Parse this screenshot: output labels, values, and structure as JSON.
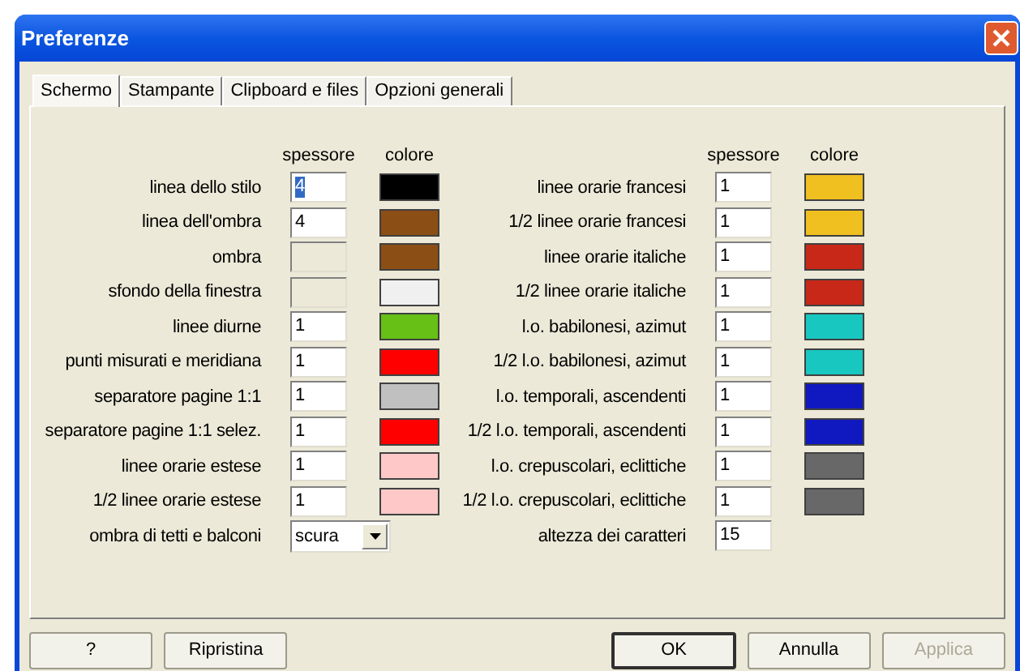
{
  "window": {
    "title": "Preferenze"
  },
  "tabs": [
    {
      "label": "Schermo",
      "selected": true
    },
    {
      "label": "Stampante",
      "selected": false
    },
    {
      "label": "Clipboard e files",
      "selected": false
    },
    {
      "label": "Opzioni generali",
      "selected": false
    }
  ],
  "headers": {
    "left": [
      "spessore",
      "colore"
    ],
    "right": [
      "spessore",
      "colore"
    ]
  },
  "left_rows": [
    {
      "kind": "color",
      "label": "linea dello stilo",
      "value": "4",
      "disabled": false,
      "selected": true,
      "color": "#000000"
    },
    {
      "kind": "color",
      "label": "linea dell'ombra",
      "value": "4",
      "disabled": false,
      "selected": false,
      "color": "#8b4e14"
    },
    {
      "kind": "color",
      "label": "ombra",
      "disabled": true,
      "color": "#8b4e14"
    },
    {
      "kind": "color",
      "label": "sfondo della finestra",
      "disabled": true,
      "color": "#f0f0f0"
    },
    {
      "kind": "color",
      "label": "linee diurne",
      "value": "1",
      "disabled": false,
      "selected": false,
      "color": "#66c016"
    },
    {
      "kind": "color",
      "label": "punti misurati e meridiana",
      "value": "1",
      "disabled": false,
      "selected": false,
      "color": "#ff0000"
    },
    {
      "kind": "color",
      "label": "separatore pagine 1:1",
      "value": "1",
      "disabled": false,
      "selected": false,
      "color": "#c0c0c0"
    },
    {
      "kind": "color",
      "label": "separatore pagine 1:1 selez.",
      "value": "1",
      "disabled": false,
      "selected": false,
      "color": "#ff0000"
    },
    {
      "kind": "color",
      "label": "linee orarie estese",
      "value": "1",
      "disabled": false,
      "selected": false,
      "color": "#ffc8c8"
    },
    {
      "kind": "color",
      "label": "1/2 linee orarie estese",
      "value": "1",
      "disabled": false,
      "selected": false,
      "color": "#ffc8c8"
    },
    {
      "kind": "select",
      "label": "ombra di tetti e balconi",
      "value": "scura"
    }
  ],
  "right_rows": [
    {
      "kind": "color",
      "label": "linee orarie francesi",
      "value": "1",
      "color": "#f0c020"
    },
    {
      "kind": "color",
      "label": "1/2 linee orarie francesi",
      "value": "1",
      "color": "#f0c020"
    },
    {
      "kind": "color",
      "label": "linee orarie italiche",
      "value": "1",
      "color": "#c82818"
    },
    {
      "kind": "color",
      "label": "1/2 linee orarie italiche",
      "value": "1",
      "color": "#c82818"
    },
    {
      "kind": "color",
      "label": "l.o. babilonesi, azimut",
      "value": "1",
      "color": "#18c8c0"
    },
    {
      "kind": "color",
      "label": "1/2 l.o. babilonesi, azimut",
      "value": "1",
      "color": "#18c8c0"
    },
    {
      "kind": "color",
      "label": "l.o. temporali, ascendenti",
      "value": "1",
      "color": "#1018c0"
    },
    {
      "kind": "color",
      "label": "1/2 l.o. temporali, ascendenti",
      "value": "1",
      "color": "#1018c0"
    },
    {
      "kind": "color",
      "label": "l.o. crepuscolari, eclittiche",
      "value": "1",
      "color": "#686868"
    },
    {
      "kind": "color",
      "label": "1/2 l.o. crepuscolari, eclittiche",
      "value": "1",
      "color": "#686868"
    },
    {
      "kind": "size",
      "label": "altezza dei caratteri",
      "value": "15"
    }
  ],
  "buttons": [
    {
      "label": "?",
      "disabled": false,
      "default": false
    },
    {
      "label": "Ripristina",
      "disabled": false,
      "default": false
    },
    {
      "label": "OK",
      "disabled": false,
      "default": true
    },
    {
      "label": "Annulla",
      "disabled": false,
      "default": false
    },
    {
      "label": "Applica",
      "disabled": true,
      "default": false
    }
  ]
}
